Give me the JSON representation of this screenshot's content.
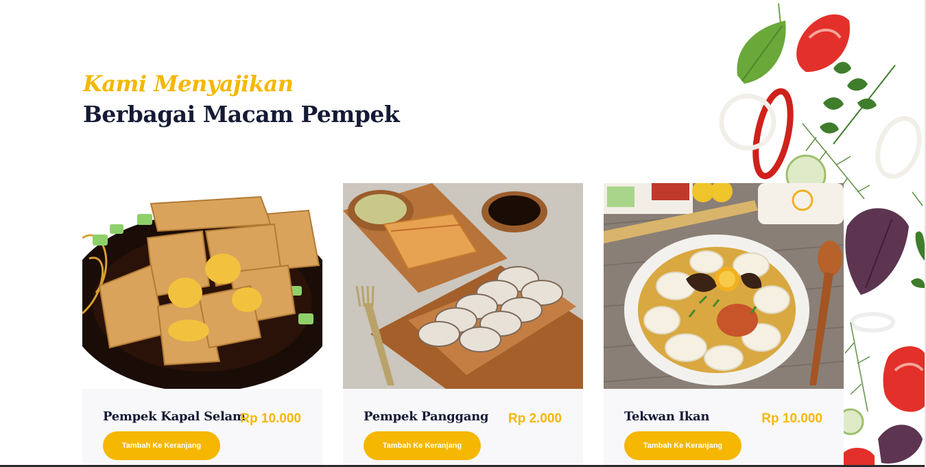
{
  "colors": {
    "accent": "#f5b700",
    "heading": "#151a35",
    "card_bg": "#f8f8fb",
    "button_text": "#ffffff"
  },
  "section": {
    "subtitle": "Kami Menyajikan",
    "title": "Berbagai Macam Pempek"
  },
  "products": [
    {
      "name": "Pempek Kapal Selam",
      "price": "Rp 10.000",
      "button": "Tambah Ke Keranjang",
      "image": "pempek-kapal-selam-photo"
    },
    {
      "name": "Pempek Panggang",
      "price": "Rp 2.000",
      "button": "Tambah Ke Keranjang",
      "image": "pempek-panggang-photo"
    },
    {
      "name": "Tekwan Ikan",
      "price": "Rp 10.000",
      "button": "Tambah Ke Keranjang",
      "image": "tekwan-ikan-photo"
    }
  ]
}
